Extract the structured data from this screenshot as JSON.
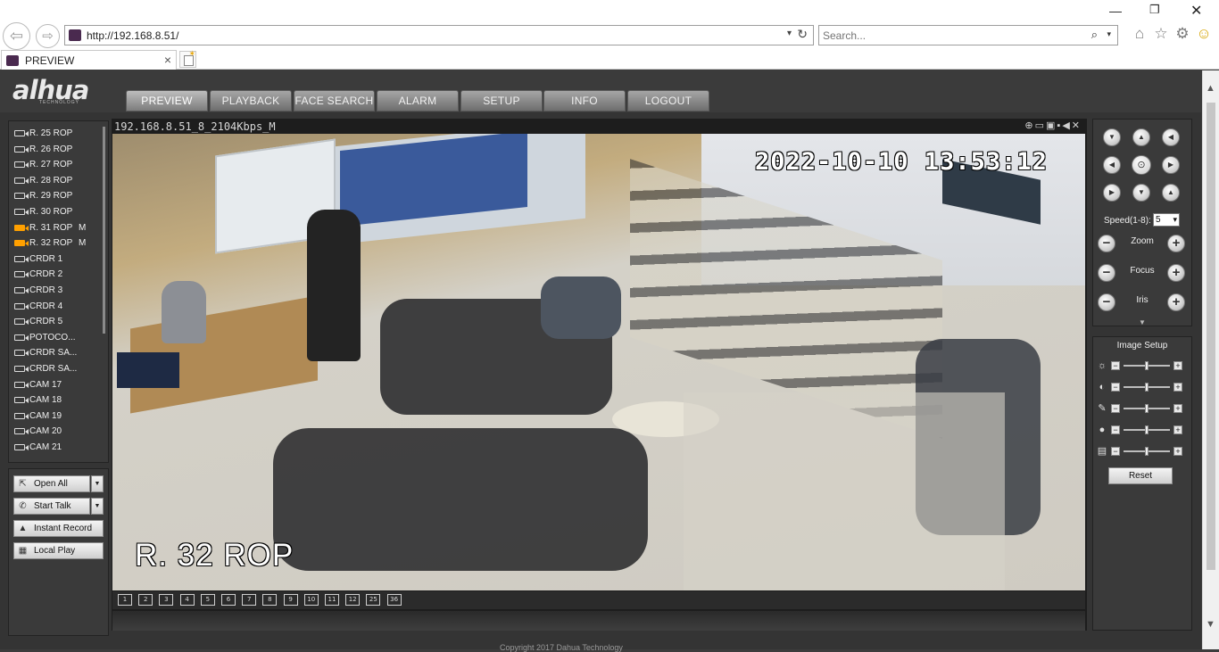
{
  "browser": {
    "url": "http://192.168.8.51/",
    "search_placeholder": "Search...",
    "tab_title": "PREVIEW"
  },
  "app": {
    "logo": "alhua",
    "logo_subtitle": "TECHNOLOGY",
    "menu": [
      "PREVIEW",
      "PLAYBACK",
      "FACE SEARCH",
      "ALARM",
      "SETUP",
      "INFO",
      "LOGOUT"
    ],
    "active_menu": "PREVIEW",
    "footer": "Copyright 2017 Dahua Technology"
  },
  "cameras": [
    {
      "name": "R. 25 ROP",
      "mark": "",
      "live": false
    },
    {
      "name": "R. 26 ROP",
      "mark": "",
      "live": false
    },
    {
      "name": "R. 27 ROP",
      "mark": "",
      "live": false
    },
    {
      "name": "R. 28 ROP",
      "mark": "",
      "live": false
    },
    {
      "name": "R. 29 ROP",
      "mark": "",
      "live": false
    },
    {
      "name": "R. 30 ROP",
      "mark": "",
      "live": false
    },
    {
      "name": "R. 31 ROP",
      "mark": "M",
      "live": true
    },
    {
      "name": "R. 32 ROP",
      "mark": "M",
      "live": true
    },
    {
      "name": "CRDR 1",
      "mark": "",
      "live": false
    },
    {
      "name": "CRDR 2",
      "mark": "",
      "live": false
    },
    {
      "name": "CRDR 3",
      "mark": "",
      "live": false
    },
    {
      "name": "CRDR 4",
      "mark": "",
      "live": false
    },
    {
      "name": "CRDR 5",
      "mark": "",
      "live": false
    },
    {
      "name": "POTOCO...",
      "mark": "",
      "live": false
    },
    {
      "name": "CRDR SA...",
      "mark": "",
      "live": false
    },
    {
      "name": "CRDR SA...",
      "mark": "",
      "live": false
    },
    {
      "name": "CAM 17",
      "mark": "",
      "live": false
    },
    {
      "name": "CAM 18",
      "mark": "",
      "live": false
    },
    {
      "name": "CAM 19",
      "mark": "",
      "live": false
    },
    {
      "name": "CAM 20",
      "mark": "",
      "live": false
    },
    {
      "name": "CAM 21",
      "mark": "",
      "live": false
    }
  ],
  "actions": {
    "open_all": "Open All",
    "start_talk": "Start Talk",
    "instant_record": "Instant Record",
    "local_play": "Local Play"
  },
  "video": {
    "stream_title": "192.168.8.51_8_2104Kbps_M",
    "timestamp": "2022-10-10 13:53:12",
    "overlay_name": "R. 32 ROP"
  },
  "layout_buttons": [
    "1",
    "2",
    "3",
    "4",
    "5",
    "6",
    "7",
    "8",
    "9",
    "10",
    "11",
    "12",
    "25",
    "36"
  ],
  "ptz": {
    "speed_label": "Speed(1-8):",
    "speed_value": "5",
    "zoom_label": "Zoom",
    "focus_label": "Focus",
    "iris_label": "Iris"
  },
  "image_setup": {
    "title": "Image Setup",
    "reset_label": "Reset",
    "rows": [
      {
        "icon": "brightness-icon",
        "level": 0.5
      },
      {
        "icon": "contrast-icon",
        "level": 0.5
      },
      {
        "icon": "saturation-icon",
        "level": 0.5
      },
      {
        "icon": "hue-icon",
        "level": 0.5
      },
      {
        "icon": "sharpness-icon",
        "level": 0.5
      }
    ]
  },
  "colors": {
    "live_camera": "#ffa000",
    "panel_bg": "#3a3a3a",
    "page_bg": "#343434"
  }
}
